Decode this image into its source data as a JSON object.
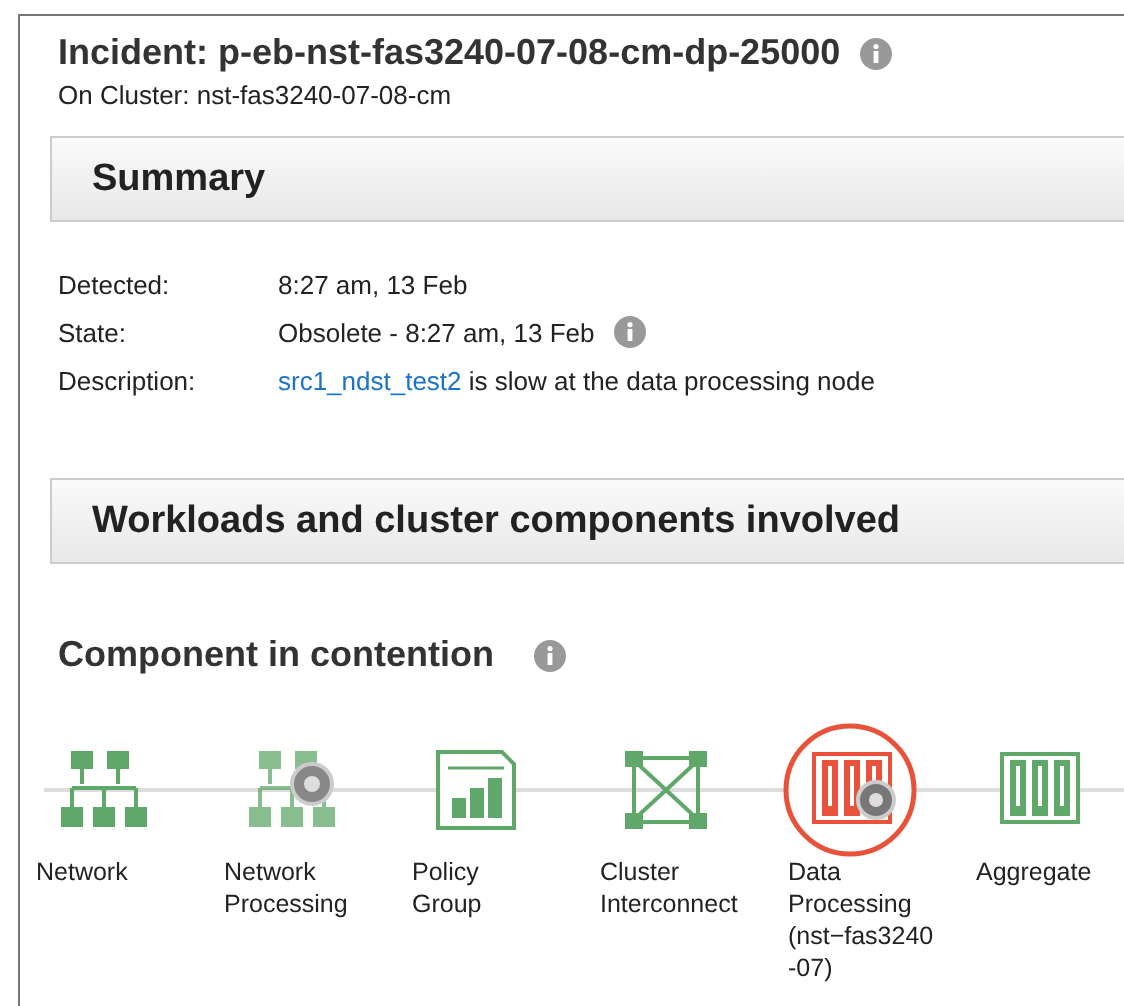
{
  "incident": {
    "title": "Incident: p-eb-nst-fas3240-07-08-cm-dp-25000",
    "cluster": "On Cluster: nst-fas3240-07-08-cm"
  },
  "summary": {
    "heading": "Summary",
    "rows": [
      {
        "label": "Detected:",
        "value": "8:27 am, 13 Feb",
        "info": false
      },
      {
        "label": "State:",
        "value": "Obsolete - 8:27 am, 13 Feb",
        "info": true
      },
      {
        "label": "Description:",
        "link": "src1_ndst_test2",
        "value": " is slow at the data processing node",
        "info": false
      }
    ]
  },
  "workloads": {
    "heading": "Workloads and cluster components involved"
  },
  "contention": {
    "heading": "Component in contention",
    "components": [
      {
        "kind": "network",
        "lines": [
          "Network"
        ],
        "in_contention": false
      },
      {
        "kind": "network-processing",
        "lines": [
          "Network",
          "Processing"
        ],
        "in_contention": false
      },
      {
        "kind": "policy-group",
        "lines": [
          "Policy",
          "Group"
        ],
        "in_contention": false
      },
      {
        "kind": "cluster-interconnect",
        "lines": [
          "Cluster",
          "Interconnect"
        ],
        "in_contention": false
      },
      {
        "kind": "data-processing",
        "lines": [
          "Data",
          "Processing",
          "(nst−fas3240",
          "-07)"
        ],
        "in_contention": true
      },
      {
        "kind": "aggregate",
        "lines": [
          "Aggregate"
        ],
        "in_contention": false
      }
    ]
  }
}
